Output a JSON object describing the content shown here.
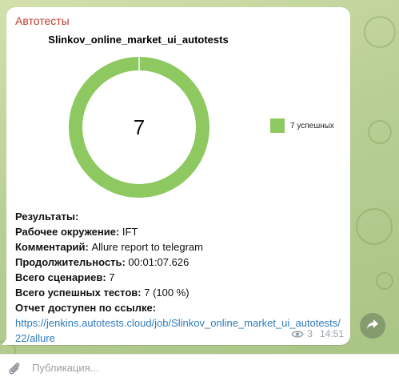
{
  "message": {
    "sender": "Автотесты",
    "chart_title": "Slinkov_online_market_ui_autotests",
    "center_value": "7",
    "legend_label": "7 успешных",
    "report": {
      "results_label": "Результаты:",
      "env_label": "Рабочее окружение:",
      "env_value": "IFT",
      "comment_label": "Комментарий:",
      "comment_value": "Allure report to telegram",
      "duration_label": "Продолжительность:",
      "duration_value": "00:01:07.626",
      "scenarios_label": "Всего сценариев:",
      "scenarios_value": "7",
      "passed_label": "Всего успешных тестов:",
      "passed_value": "7 (100 %)",
      "link_label": "Отчет доступен по ссылке:",
      "link_url": "https://jenkins.autotests.cloud/job/Slinkov_online_market_ui_autotests/22/allure"
    },
    "views": "3",
    "time": "14:51"
  },
  "chart_data": {
    "type": "pie",
    "title": "Slinkov_online_market_ui_autotests",
    "categories": [
      "7 успешных"
    ],
    "values": [
      7
    ],
    "donut": true,
    "legend_position": "right",
    "colors": [
      "#8ec860"
    ]
  },
  "compose": {
    "placeholder": "Публикация..."
  },
  "icons": {
    "views": "eye-icon",
    "share": "share-arrow-icon",
    "attach": "paperclip-icon"
  },
  "colors": {
    "sender": "#c0392b",
    "link": "#2e7bbf",
    "success": "#8ec860"
  }
}
